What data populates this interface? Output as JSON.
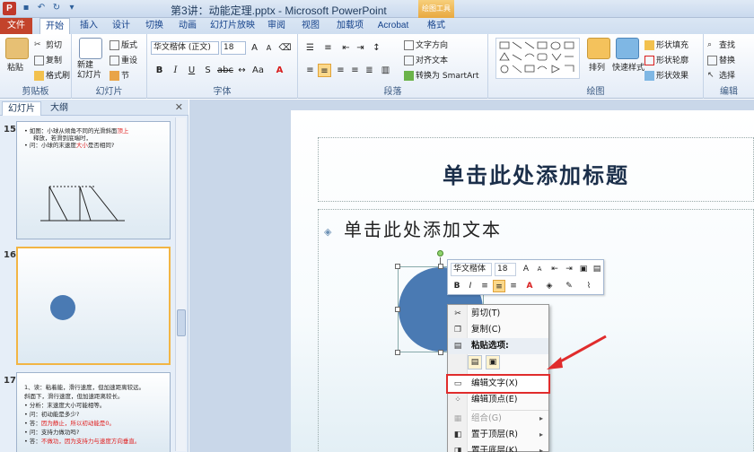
{
  "window": {
    "title": "第3讲：动能定理.pptx - Microsoft PowerPoint",
    "app_icon": "P",
    "context_tool": "绘图工具"
  },
  "tabs": [
    {
      "label": "文件"
    },
    {
      "label": "开始"
    },
    {
      "label": "插入"
    },
    {
      "label": "设计"
    },
    {
      "label": "切换"
    },
    {
      "label": "动画"
    },
    {
      "label": "幻灯片放映"
    },
    {
      "label": "审阅"
    },
    {
      "label": "视图"
    },
    {
      "label": "加载项"
    },
    {
      "label": "Acrobat"
    },
    {
      "label": "格式"
    }
  ],
  "ribbon": {
    "clipboard": {
      "label": "剪贴板",
      "paste": "粘贴",
      "cut": "剪切",
      "copy": "复制",
      "format_painter": "格式刷"
    },
    "slides": {
      "label": "幻灯片",
      "new_slide": "新建\n幻灯片",
      "layout": "版式",
      "reset": "重设",
      "section": "节"
    },
    "font": {
      "label": "字体",
      "name": "华文楷体 (正文)",
      "size": "18"
    },
    "paragraph": {
      "label": "段落",
      "text_direction": "文字方向",
      "align_text": "对齐文本",
      "smartart": "转换为 SmartArt"
    },
    "drawing": {
      "label": "绘图",
      "arrange": "排列",
      "quick_styles": "快速样式",
      "fill": "形状填充",
      "outline": "形状轮廓",
      "effects": "形状效果"
    },
    "editing": {
      "label": "编辑",
      "find": "查找",
      "replace": "替换",
      "select": "选择"
    }
  },
  "panel": {
    "tab_slides": "幻灯片",
    "tab_outline": "大纲",
    "slides": [
      {
        "number": "15",
        "lines": [
          {
            "text": "如图：小球从倾角不同的光滑斜面",
            "red": "顶上",
            "rest": "释放，若滑到底端时，"
          },
          {
            "text": "问：小球的末速度",
            "red": "大小",
            "rest": "是否相同?"
          }
        ]
      },
      {
        "number": "16"
      },
      {
        "number": "17",
        "lines": [
          {
            "text": "1、读：粘着能，滑行速度，但加速距离较远。",
            "red": "",
            "rest": ""
          },
          {
            "text": "       斜面下，滑行速度，但加速距离较长。",
            "red": "",
            "rest": ""
          },
          {
            "text": "• 分析：末速度大小可能相等。",
            "red": "",
            "rest": ""
          },
          {
            "text": "• 问：初动能是多少?",
            "red": "",
            "rest": ""
          },
          {
            "text": "• 答：",
            "red": "因为静止，所以初动能是0。",
            "rest": ""
          },
          {
            "text": "• 问：支持力做功吗?",
            "red": "",
            "rest": ""
          },
          {
            "text": "• 答：",
            "red": "不做功，因为支持力与速度方向垂直。",
            "rest": ""
          }
        ]
      }
    ]
  },
  "slide": {
    "title_placeholder": "单击此处添加标题",
    "body_placeholder": "单击此处添加文本"
  },
  "minitoolbar": {
    "font": "华文楷体",
    "size": "18"
  },
  "context_menu": {
    "items": [
      {
        "label": "剪切(T)",
        "icon": "scissors-icon"
      },
      {
        "label": "复制(C)",
        "icon": "copy-icon"
      },
      {
        "label": "粘贴选项:",
        "icon": "paste-icon"
      },
      {
        "label": "编辑文字(X)",
        "icon": "edit-text-icon"
      },
      {
        "label": "编辑顶点(E)",
        "icon": "edit-points-icon"
      },
      {
        "label": "组合(G)",
        "icon": "group-icon"
      },
      {
        "label": "置于顶层(R)",
        "icon": "bring-front-icon"
      },
      {
        "label": "置于底层(K)",
        "icon": "send-back-icon"
      }
    ]
  },
  "colors": {
    "file_tab": "#c3432b",
    "shape_fill": "#4a7ab3",
    "highlight": "#e02c2c"
  }
}
